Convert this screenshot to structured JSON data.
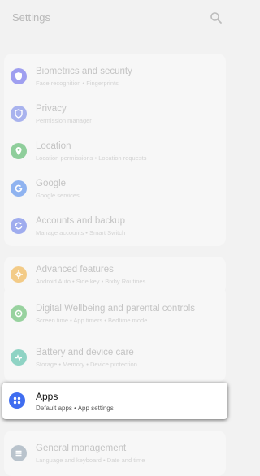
{
  "header": {
    "title": "Settings",
    "search_icon": "search-icon"
  },
  "items": [
    {
      "label": "Biometrics and security",
      "sub": "Face recognition  •  Fingerprints",
      "icon": "shield-icon",
      "color": "#9f9ff0"
    },
    {
      "label": "Privacy",
      "sub": "Permission manager",
      "icon": "privacy-icon",
      "color": "#a9b3ee"
    },
    {
      "label": "Location",
      "sub": "Location permissions  •  Location requests",
      "icon": "location-pin-icon",
      "color": "#8fce9b"
    },
    {
      "label": "Google",
      "sub": "Google services",
      "icon": "google-icon",
      "color": "#8fb3f0"
    },
    {
      "label": "Accounts and backup",
      "sub": "Manage accounts  •  Smart Switch",
      "icon": "sync-icon",
      "color": "#9facee"
    },
    {
      "label": "Advanced features",
      "sub": "Android Auto  •  Side key  •  Bixby Routines",
      "icon": "advanced-features-icon",
      "color": "#f3cb87"
    },
    {
      "label": "Digital Wellbeing and parental controls",
      "sub": "Screen time  •  App timers  •  Bedtime mode",
      "icon": "wellbeing-icon",
      "color": "#98d29f"
    },
    {
      "label": "Battery and device care",
      "sub": "Storage  •  Memory  •  Device protection",
      "icon": "device-care-icon",
      "color": "#8fd3c4"
    },
    {
      "label": "Apps",
      "sub": "Default apps  •  App settings",
      "icon": "apps-grid-icon",
      "color": "#3f6df0"
    },
    {
      "label": "General management",
      "sub": "Language and keyboard  •  Date and time",
      "icon": "general-management-icon",
      "color": "#b9c3cc"
    }
  ]
}
